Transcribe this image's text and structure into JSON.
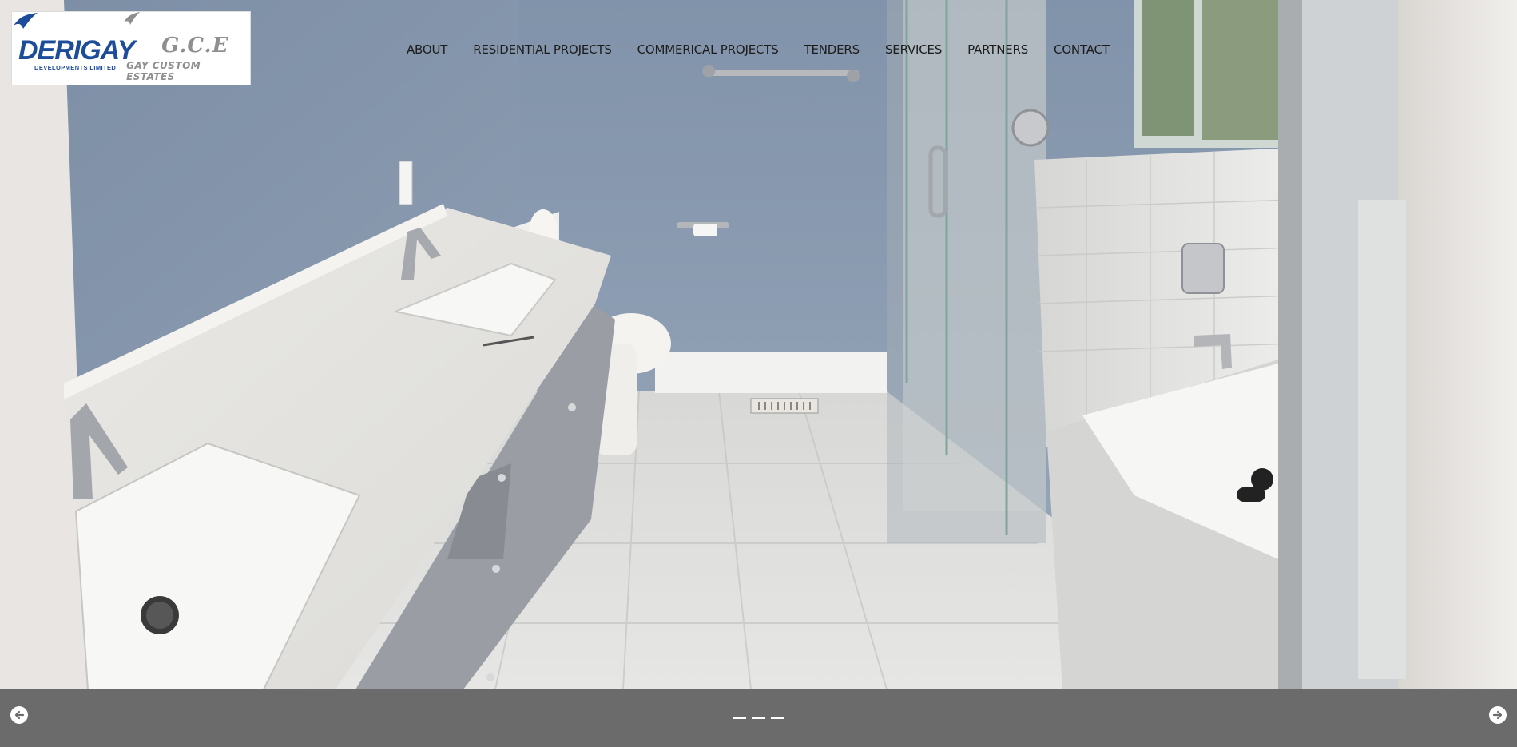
{
  "header": {
    "logo": {
      "brand_left": "DERIGAY",
      "brand_left_sub": "DEVELOPMENTS LIMITED",
      "brand_right": "G.C.E",
      "brand_right_sub": "GAY CUSTOM ESTATES",
      "brand_color": "#1d4c9a",
      "secondary_color": "#8f8f8f"
    },
    "nav": [
      {
        "label": "ABOUT"
      },
      {
        "label": "RESIDENTIAL PROJECTS"
      },
      {
        "label": "COMMERICAL PROJECTS"
      },
      {
        "label": "TENDERS"
      },
      {
        "label": "SERVICES"
      },
      {
        "label": "PARTNERS"
      },
      {
        "label": "CONTACT"
      }
    ]
  },
  "slider": {
    "image": "bathroom-photo",
    "prev_icon": "arrow-left-icon",
    "next_icon": "arrow-right-icon",
    "indicator_count": 3,
    "bar_color": "#6b6b6b"
  }
}
